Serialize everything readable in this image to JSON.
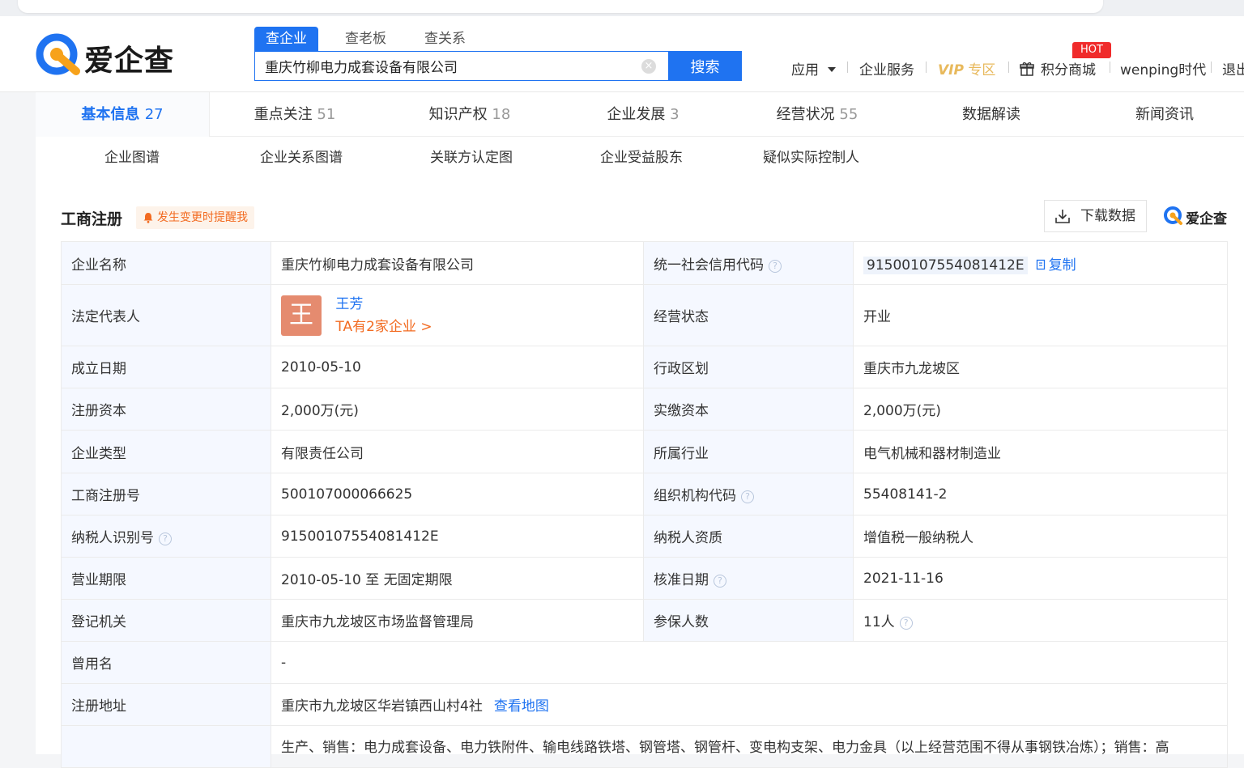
{
  "brand": {
    "name": "爱企查",
    "accent": "#1f73f1",
    "badge_color": "#f02b2b"
  },
  "search": {
    "tabs": [
      "查企业",
      "查老板",
      "查关系"
    ],
    "value": "重庆竹柳电力成套设备有限公司",
    "button": "搜索",
    "clear": "×"
  },
  "nav": {
    "app": "应用",
    "enterprise_service": "企业服务",
    "vip": "VIP",
    "vip_zone": "专区",
    "points_mall": "积分商城",
    "hot": "HOT",
    "user": "wenping时代",
    "logout": "退出"
  },
  "tabs": [
    {
      "label": "基本信息",
      "count": "27"
    },
    {
      "label": "重点关注",
      "count": "51"
    },
    {
      "label": "知识产权",
      "count": "18"
    },
    {
      "label": "企业发展",
      "count": "3"
    },
    {
      "label": "经营状况",
      "count": "55"
    },
    {
      "label": "数据解读",
      "count": ""
    },
    {
      "label": "新闻资讯",
      "count": ""
    }
  ],
  "subtabs": [
    "企业图谱",
    "企业关系图谱",
    "关联方认定图",
    "企业受益股东",
    "疑似实际控制人"
  ],
  "section": {
    "title": "工商注册",
    "remind": "发生变更时提醒我",
    "download": "下载数据",
    "logo_text": "爱企查"
  },
  "info": {
    "company_name_label": "企业名称",
    "company_name": "重庆竹柳电力成套设备有限公司",
    "credit_code_label": "统一社会信用代码",
    "credit_code": "91500107554081412E",
    "copy": "复制",
    "legal_rep_label": "法定代表人",
    "legal_rep_avatar": "王",
    "legal_rep_name": "王芳",
    "legal_rep_more": "TA有2家企业 >",
    "status_label": "经营状态",
    "status": "开业",
    "found_date_label": "成立日期",
    "found_date": "2010-05-10",
    "region_label": "行政区划",
    "region": "重庆市九龙坡区",
    "reg_capital_label": "注册资本",
    "reg_capital": "2,000万(元)",
    "paid_capital_label": "实缴资本",
    "paid_capital": "2,000万(元)",
    "type_label": "企业类型",
    "type": "有限责任公司",
    "industry_label": "所属行业",
    "industry": "电气机械和器材制造业",
    "reg_no_label": "工商注册号",
    "reg_no": "500107000066625",
    "org_code_label": "组织机构代码",
    "org_code": "55408141-2",
    "tax_id_label": "纳税人识别号",
    "tax_id": "91500107554081412E",
    "tax_qual_label": "纳税人资质",
    "tax_qual": "增值税一般纳税人",
    "term_label": "营业期限",
    "term": "2010-05-10 至 无固定期限",
    "approve_date_label": "核准日期",
    "approve_date": "2021-11-16",
    "authority_label": "登记机关",
    "authority": "重庆市九龙坡区市场监督管理局",
    "insured_label": "参保人数",
    "insured": "11人",
    "former_name_label": "曾用名",
    "former_name": "-",
    "address_label": "注册地址",
    "address": "重庆市九龙坡区华岩镇西山村4社",
    "view_map": "查看地图",
    "scope": "生产、销售：电力成套设备、电力铁附件、输电线路铁塔、钢管塔、钢管杆、变电构支架、电力金具（以上经营范围不得从事钢铁冶炼）；销售：高"
  }
}
